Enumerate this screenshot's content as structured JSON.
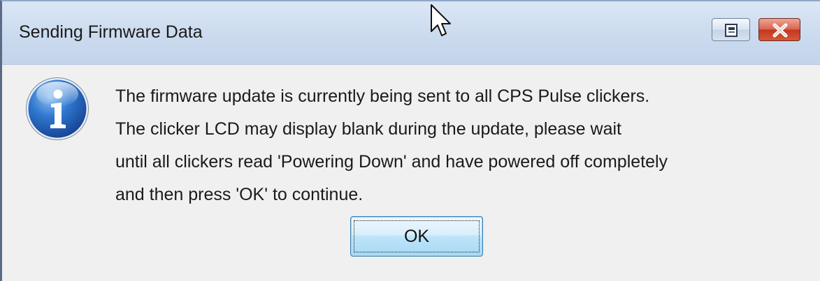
{
  "window": {
    "title": "Sending Firmware Data"
  },
  "titlebar_buttons": {
    "restore_icon": "restore-icon",
    "close_icon": "close-icon",
    "close_color": "#c3381d"
  },
  "dialog": {
    "icon": "info-icon",
    "icon_color": "#1f5fb8",
    "message_lines": [
      "The firmware update is currently being sent to all CPS Pulse clickers.",
      "The clicker LCD may display blank during the update, please wait",
      "until all clickers read 'Powering Down' and have powered off completely",
      "and then press 'OK' to continue."
    ],
    "ok_label": "OK"
  }
}
